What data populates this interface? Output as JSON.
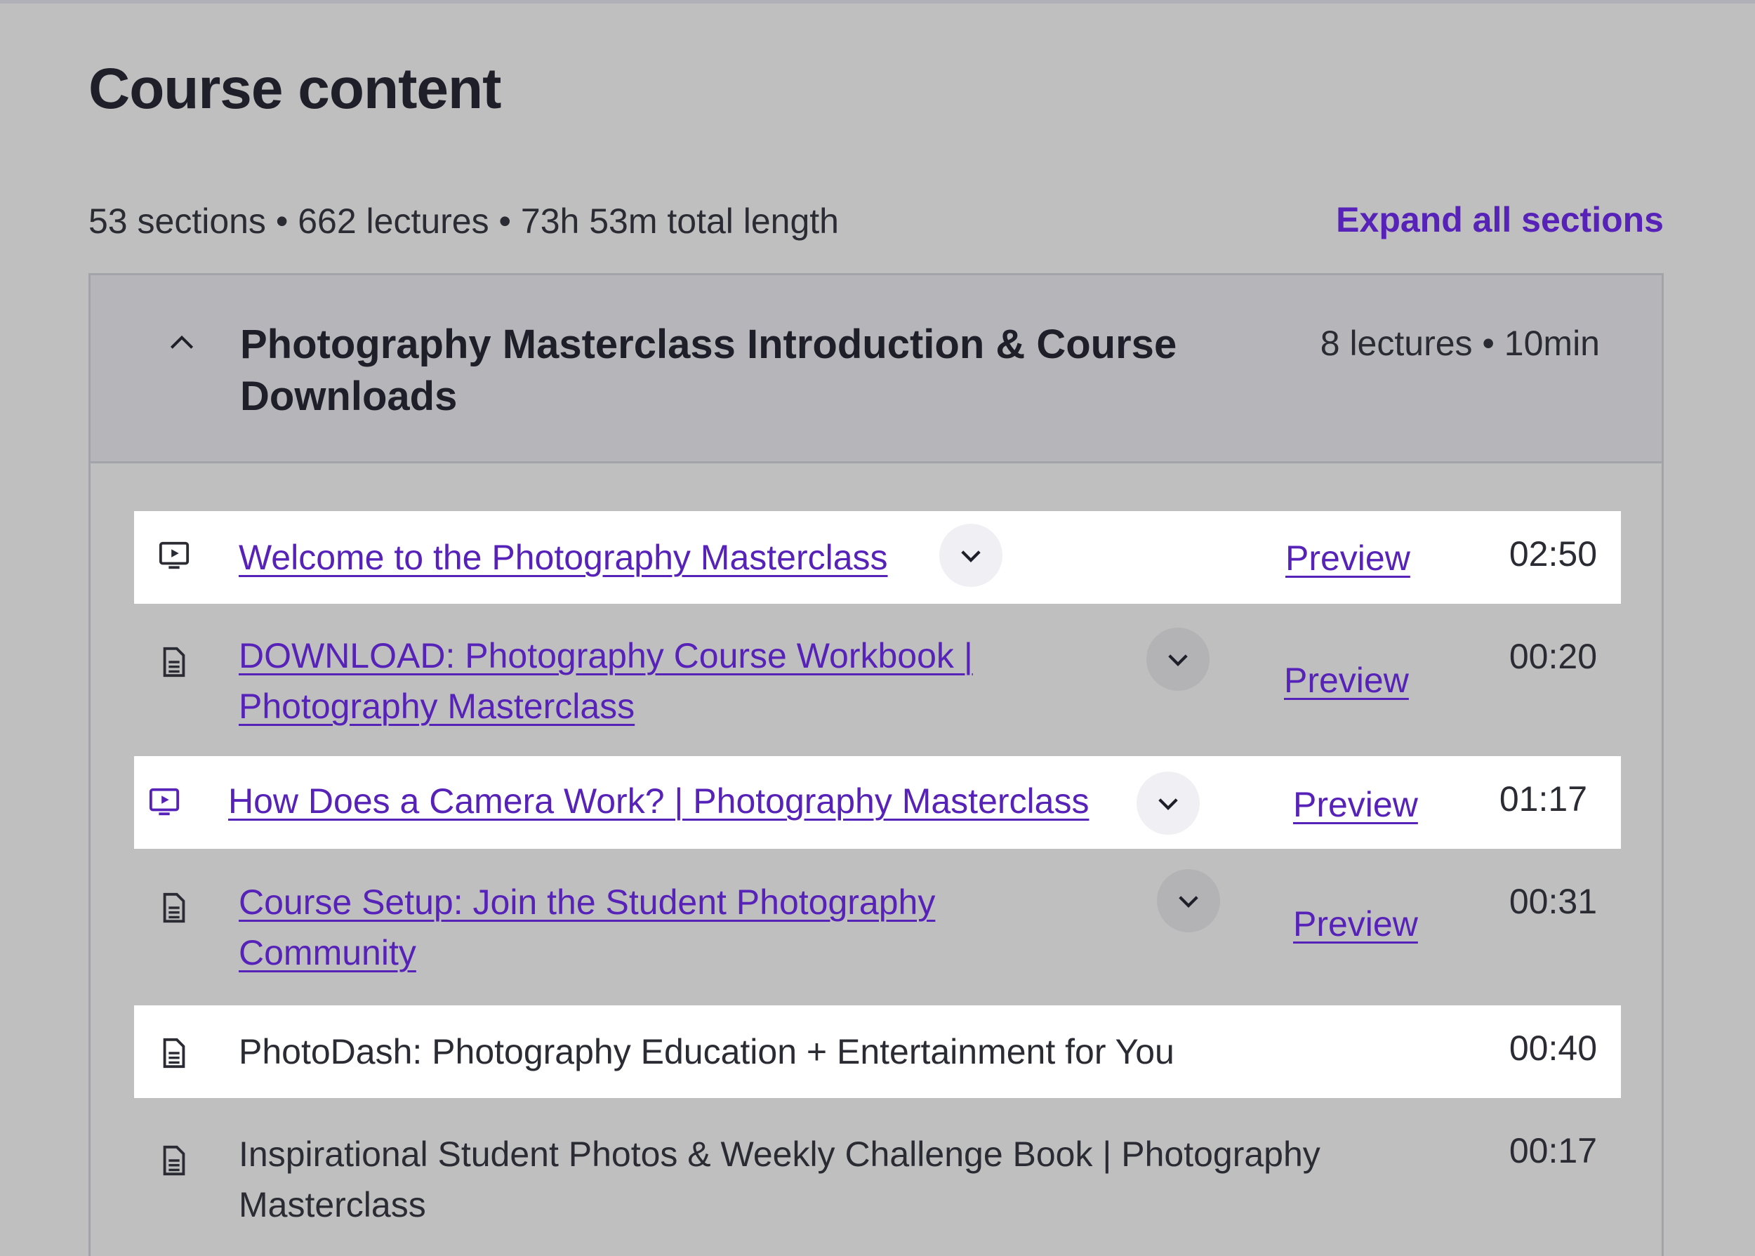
{
  "page": {
    "title": "Course content",
    "summary": "53 sections • 662 lectures • 73h 53m total length",
    "expand_all_label": "Expand all sections"
  },
  "section": {
    "title": "Photography Masterclass Introduction & Course Downloads",
    "meta": "8 lectures • 10min",
    "expanded": true
  },
  "lectures": [
    {
      "title": "Welcome to the Photography Masterclass",
      "type": "video",
      "preview": "Preview",
      "duration": "02:50",
      "highlighted": true
    },
    {
      "title": "DOWNLOAD: Photography Course Workbook | Photography Masterclass",
      "type": "document",
      "preview": "Preview",
      "duration": "00:20",
      "highlighted": false
    },
    {
      "title": "How Does a Camera Work? | Photography Masterclass",
      "type": "video",
      "preview": "Preview",
      "duration": "01:17",
      "highlighted": true
    },
    {
      "title": "Course Setup: Join the Student Photography Community",
      "type": "document",
      "preview": "Preview",
      "duration": "00:31",
      "highlighted": false
    },
    {
      "title": "PhotoDash: Photography Education + Entertainment for You",
      "type": "document",
      "preview": "",
      "duration": "00:40",
      "highlighted": true
    },
    {
      "title": "Inspirational Student Photos & Weekly Challenge Book | Photography Masterclass",
      "type": "document",
      "preview": "",
      "duration": "00:17",
      "highlighted": false
    }
  ],
  "colors": {
    "background": "#bfbfbf",
    "accent": "#5622b8",
    "text": "#1f1f2a",
    "highlight_row": "#ffffff"
  },
  "icons": {
    "video": "video-play-icon",
    "document": "document-icon",
    "toggle": "chevron-down-icon",
    "section_toggle": "chevron-up-icon"
  }
}
